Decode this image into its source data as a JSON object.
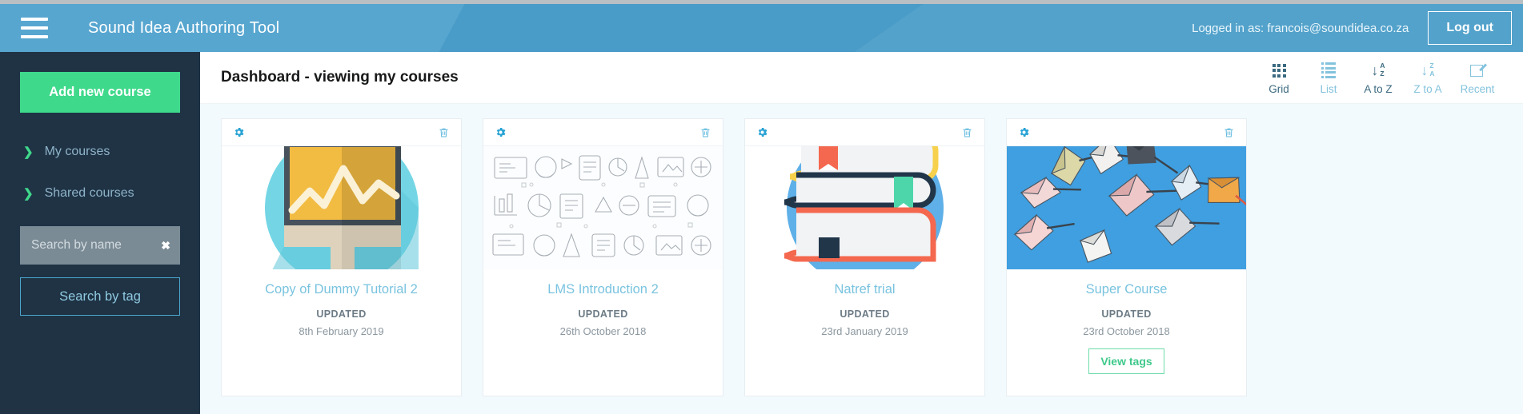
{
  "topbar": {
    "menu_icon": "hamburger-icon",
    "brand": "Sound Idea Authoring Tool",
    "logged_in_text": "Logged in as: francois@soundidea.co.za",
    "logout_label": "Log out"
  },
  "sidebar": {
    "add_course_label": "Add new course",
    "nav_items": [
      {
        "label": "My courses",
        "icon": "chevron-right-icon"
      },
      {
        "label": "Shared courses",
        "icon": "chevron-right-icon"
      }
    ],
    "search": {
      "placeholder": "Search by name",
      "value": "",
      "clear_icon": "close-icon"
    },
    "search_tag_label": "Search by tag"
  },
  "content": {
    "page_title": "Dashboard - viewing my courses",
    "view_tools": [
      {
        "label": "Grid",
        "icon": "grid-icon",
        "active": true
      },
      {
        "label": "List",
        "icon": "list-icon",
        "active": false
      },
      {
        "label": "A to Z",
        "icon": "sort-az-icon",
        "active": true
      },
      {
        "label": "Z to A",
        "icon": "sort-za-icon",
        "active": false
      },
      {
        "label": "Recent",
        "icon": "edit-pencil-icon",
        "active": false
      }
    ],
    "updated_label": "UPDATED",
    "cards": [
      {
        "title": "Copy of Dummy Tutorial 2",
        "updated_label": "UPDATED",
        "date": "8th February 2019",
        "thumb": "monitor-chart-illustration",
        "has_view_tags": false,
        "view_tags_label": "",
        "settings_icon": "gear-icon",
        "delete_icon": "trash-icon"
      },
      {
        "title": "LMS Introduction 2",
        "updated_label": "UPDATED",
        "date": "26th October 2018",
        "thumb": "doodle-pattern-illustration",
        "has_view_tags": false,
        "view_tags_label": "",
        "settings_icon": "gear-icon",
        "delete_icon": "trash-icon"
      },
      {
        "title": "Natref trial",
        "updated_label": "UPDATED",
        "date": "23rd January 2019",
        "thumb": "stacked-books-illustration",
        "has_view_tags": false,
        "view_tags_label": "",
        "settings_icon": "gear-icon",
        "delete_icon": "trash-icon"
      },
      {
        "title": "Super Course",
        "updated_label": "UPDATED",
        "date": "23rd October 2018",
        "thumb": "origami-cranes-photo",
        "has_view_tags": true,
        "view_tags_label": "View tags",
        "settings_icon": "gear-icon",
        "delete_icon": "trash-icon"
      }
    ]
  },
  "colors": {
    "header_blue": "#4a9fcc",
    "sidebar_navy": "#1f3345",
    "accent_green": "#3fd98b",
    "link_blue": "#79c3df",
    "tool_active": "#3b6a80",
    "tool_inactive": "#84c3dd",
    "content_bg": "#f2fafd"
  }
}
